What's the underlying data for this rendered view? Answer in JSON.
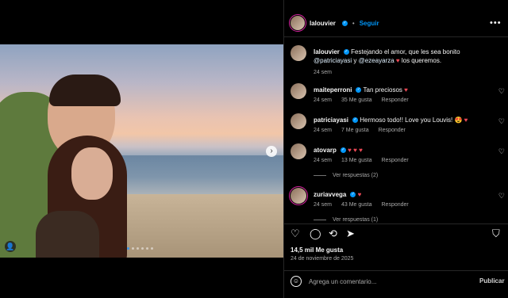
{
  "post": {
    "author": "lalouvier",
    "follow_label": "Seguir",
    "separator": "•"
  },
  "caption": {
    "username": "lalouvier",
    "text_before": "Festejando el amor, que les sea bonito",
    "mention1": "@patriciayasi",
    "and": "y",
    "mention2": "@ezeayarza",
    "heart": "♥",
    "text_after": "los queremos.",
    "time": "24 sem"
  },
  "comments": [
    {
      "username": "maiteperroni",
      "text": "Tan preciosos",
      "emoji": "♥",
      "time": "24 sem",
      "likes": "35 Me gusta",
      "reply": "Responder"
    },
    {
      "username": "patriciayasi",
      "text": "Hermoso todo!! Love you Louvis!",
      "emoji": "😍 ♥",
      "time": "24 sem",
      "likes": "7 Me gusta",
      "reply": "Responder"
    },
    {
      "username": "atovarp",
      "text": "",
      "emoji": "♥ ♥ ♥",
      "time": "24 sem",
      "likes": "13 Me gusta",
      "reply": "Responder",
      "view_replies": "Ver respuestas (2)"
    },
    {
      "username": "zuriavvega",
      "text": "",
      "emoji": "♥",
      "time": "24 sem",
      "likes": "43 Me gusta",
      "reply": "Responder",
      "view_replies": "Ver respuestas (1)"
    }
  ],
  "actions": {
    "like": "heart-icon",
    "comment": "comment-icon",
    "share": "share-icon",
    "send": "send-icon",
    "save": "bookmark-icon"
  },
  "likes_count": "14,5 mil Me gusta",
  "date": "24 de noviembre de 2025",
  "composer": {
    "placeholder": "Agrega un comentario...",
    "publish": "Publicar"
  },
  "carousel": {
    "slides": 6,
    "active_index": 0
  },
  "colors": {
    "accent": "#0095f6",
    "heart": "#ed4956",
    "background": "#000000"
  }
}
